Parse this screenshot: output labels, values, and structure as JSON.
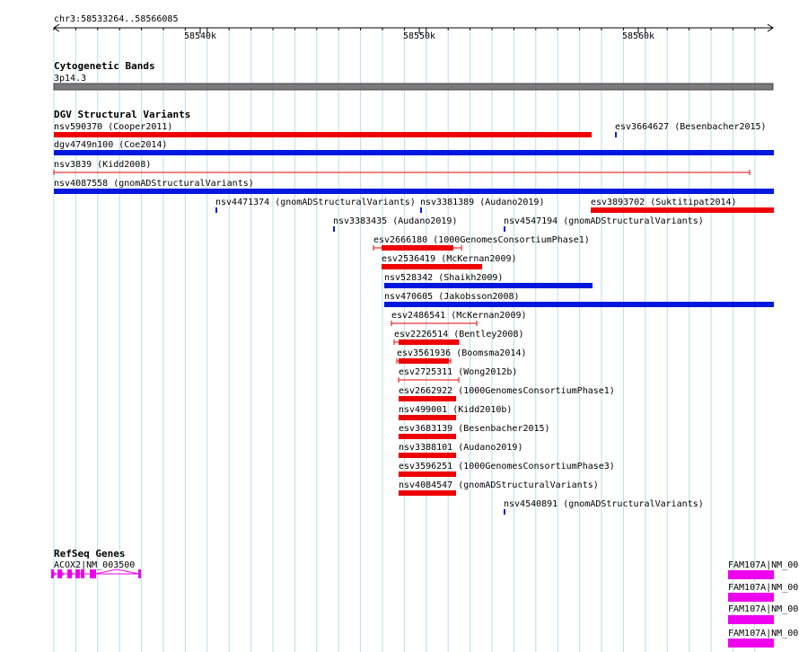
{
  "location": "chr3:58533264..58566085",
  "ruler": {
    "labels": [
      "58540k",
      "58550k",
      "58560k"
    ]
  },
  "tracks": {
    "cytoband": {
      "title": "Cytogenetic Bands",
      "band": "3p14.3"
    },
    "dgv": {
      "title": "DGV Structural Variants",
      "colors": {
        "red": "#ee0000",
        "blue": "#0018dd"
      },
      "features": [
        {
          "id": "nsv590370",
          "study": "(Cooper2011)",
          "color": "red",
          "thick": true
        },
        {
          "id": "esv3664627",
          "study": "(Besenbacher2015)",
          "color": "blue",
          "thick": false
        },
        {
          "id": "dgv4749n100",
          "study": "(Coe2014)",
          "color": "blue",
          "thick": true
        },
        {
          "id": "nsv3839",
          "study": "(Kidd2008)",
          "color": "red",
          "thick": false
        },
        {
          "id": "nsv4087558",
          "study": "(gnomADStructuralVariants)",
          "color": "blue",
          "thick": true
        },
        {
          "id": "nsv4471374",
          "study": "(gnomADStructuralVariants)",
          "color": "blue",
          "thick": false
        },
        {
          "id": "nsv3381389",
          "study": "(Audano2019)",
          "color": "blue",
          "thick": false
        },
        {
          "id": "esv3893702",
          "study": "(Suktitipat2014)",
          "color": "red",
          "thick": true
        },
        {
          "id": "nsv3383435",
          "study": "(Audano2019)",
          "color": "blue",
          "thick": false
        },
        {
          "id": "nsv4547194",
          "study": "(gnomADStructuralVariants)",
          "color": "blue",
          "thick": false
        },
        {
          "id": "esv2666180",
          "study": "(1000GenomesConsortiumPhase1)",
          "color": "red",
          "thick": true
        },
        {
          "id": "esv2536419",
          "study": "(McKernan2009)",
          "color": "red",
          "thick": true
        },
        {
          "id": "nsv528342",
          "study": "(Shaikh2009)",
          "color": "blue",
          "thick": true
        },
        {
          "id": "nsv470605",
          "study": "(Jakobsson2008)",
          "color": "blue",
          "thick": true
        },
        {
          "id": "esv2486541",
          "study": "(McKernan2009)",
          "color": "red",
          "thick": false
        },
        {
          "id": "esv2226514",
          "study": "(Bentley2008)",
          "color": "red",
          "thick": true
        },
        {
          "id": "esv3561936",
          "study": "(Boomsma2014)",
          "color": "red",
          "thick": true
        },
        {
          "id": "esv2725311",
          "study": "(Wong2012b)",
          "color": "red",
          "thick": false
        },
        {
          "id": "esv2662922",
          "study": "(1000GenomesConsortiumPhase1)",
          "color": "red",
          "thick": true
        },
        {
          "id": "nsv499001",
          "study": "(Kidd2010b)",
          "color": "red",
          "thick": true
        },
        {
          "id": "esv3683139",
          "study": "(Besenbacher2015)",
          "color": "red",
          "thick": true
        },
        {
          "id": "nsv3388101",
          "study": "(Audano2019)",
          "color": "red",
          "thick": true
        },
        {
          "id": "esv3596251",
          "study": "(1000GenomesConsortiumPhase3)",
          "color": "red",
          "thick": true
        },
        {
          "id": "nsv4084547",
          "study": "(gnomADStructuralVariants)",
          "color": "red",
          "thick": true
        },
        {
          "id": "nsv4540891",
          "study": "(gnomADStructuralVariants)",
          "color": "blue",
          "thick": false
        }
      ]
    },
    "refseq": {
      "title": "RefSeq Genes",
      "color": "#ee00ee",
      "genes": [
        {
          "label": "ACOX2|NM_003500"
        },
        {
          "label": "FAM107A|NM_00"
        },
        {
          "label": "FAM107A|NM_00"
        },
        {
          "label": "FAM107A|NM_00"
        },
        {
          "label": "FAM107A|NM_00"
        }
      ]
    }
  }
}
